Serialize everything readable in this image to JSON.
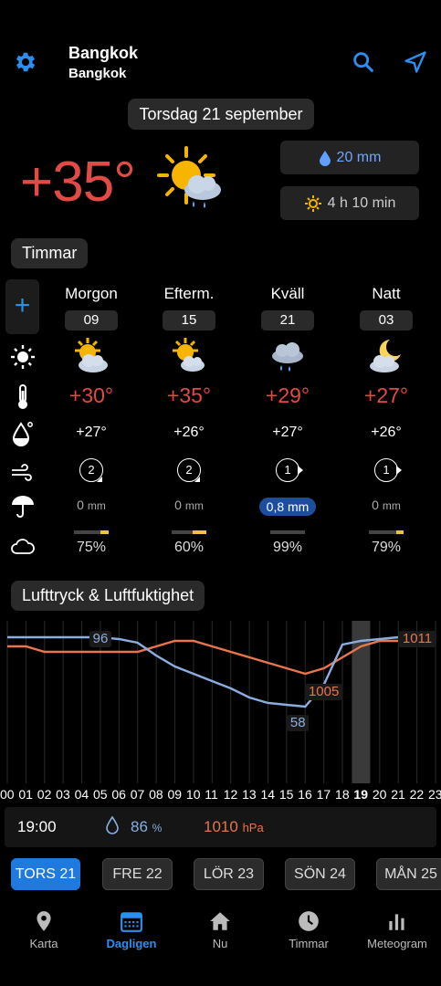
{
  "header": {
    "city": "Bangkok",
    "region": "Bangkok"
  },
  "date": "Torsdag 21 september",
  "current": {
    "temp": "+35°",
    "rain": "20 mm",
    "sunshine": "4 h 10 min"
  },
  "sections": {
    "hours": "Timmar",
    "pressure": "Lufttryck & Luftfuktighet"
  },
  "periods": [
    {
      "label": "Morgon",
      "hour": "09",
      "temp": "+30°",
      "feels": "+27°",
      "wind": "2",
      "rain": "0",
      "rain_unit": "mm",
      "cloud": "75%",
      "cloud_frac": 0.25
    },
    {
      "label": "Efterm.",
      "hour": "15",
      "temp": "+35°",
      "feels": "+26°",
      "wind": "2",
      "rain": "0",
      "rain_unit": "mm",
      "cloud": "60%",
      "cloud_frac": 0.4
    },
    {
      "label": "Kväll",
      "hour": "21",
      "temp": "+29°",
      "feels": "+27°",
      "wind": "1",
      "rain": "0,8 mm",
      "rain_unit": "",
      "cloud": "99%",
      "cloud_frac": 0.0
    },
    {
      "label": "Natt",
      "hour": "03",
      "temp": "+27°",
      "feels": "+26°",
      "wind": "1",
      "rain": "0",
      "rain_unit": "mm",
      "cloud": "79%",
      "cloud_frac": 0.2
    }
  ],
  "chart_data": {
    "type": "line",
    "x": [
      "00",
      "01",
      "02",
      "03",
      "04",
      "05",
      "06",
      "07",
      "08",
      "09",
      "10",
      "11",
      "12",
      "13",
      "14",
      "15",
      "16",
      "17",
      "18",
      "19",
      "20",
      "21",
      "22",
      "23"
    ],
    "series": [
      {
        "values": [
          96,
          96,
          96,
          96,
          96,
          96,
          95,
          93,
          86,
          80,
          76,
          72,
          68,
          63,
          60,
          59,
          58,
          70,
          92,
          94,
          95,
          96,
          96,
          96
        ]
      },
      {
        "values": [
          1010,
          1010,
          1009,
          1009,
          1009,
          1009,
          1009,
          1009,
          1010,
          1011,
          1011,
          1010,
          1009,
          1008,
          1007,
          1006,
          1005,
          1006,
          1008,
          1010,
          1011,
          1011,
          1011,
          1011
        ]
      }
    ],
    "labels": {
      "humidity_high": "96",
      "humidity_low": "58",
      "pressure_low": "1005",
      "pressure_high": "1011"
    },
    "selected_hour": "19"
  },
  "readout": {
    "time": "19:00",
    "humidity": "86",
    "humidity_unit": "%",
    "pressure": "1010",
    "pressure_unit": "hPa"
  },
  "days": [
    {
      "name": "TORS",
      "num": "21"
    },
    {
      "name": "FRE",
      "num": "22"
    },
    {
      "name": "LÖR",
      "num": "23"
    },
    {
      "name": "SÖN",
      "num": "24"
    },
    {
      "name": "MÅN",
      "num": "25"
    }
  ],
  "nav": [
    "Karta",
    "Dagligen",
    "Nu",
    "Timmar",
    "Meteogram"
  ],
  "colors": {
    "accent": "#2b8ff0",
    "temp": "#e24a44",
    "humidity": "#8aaee0",
    "pressure": "#e8754c"
  }
}
